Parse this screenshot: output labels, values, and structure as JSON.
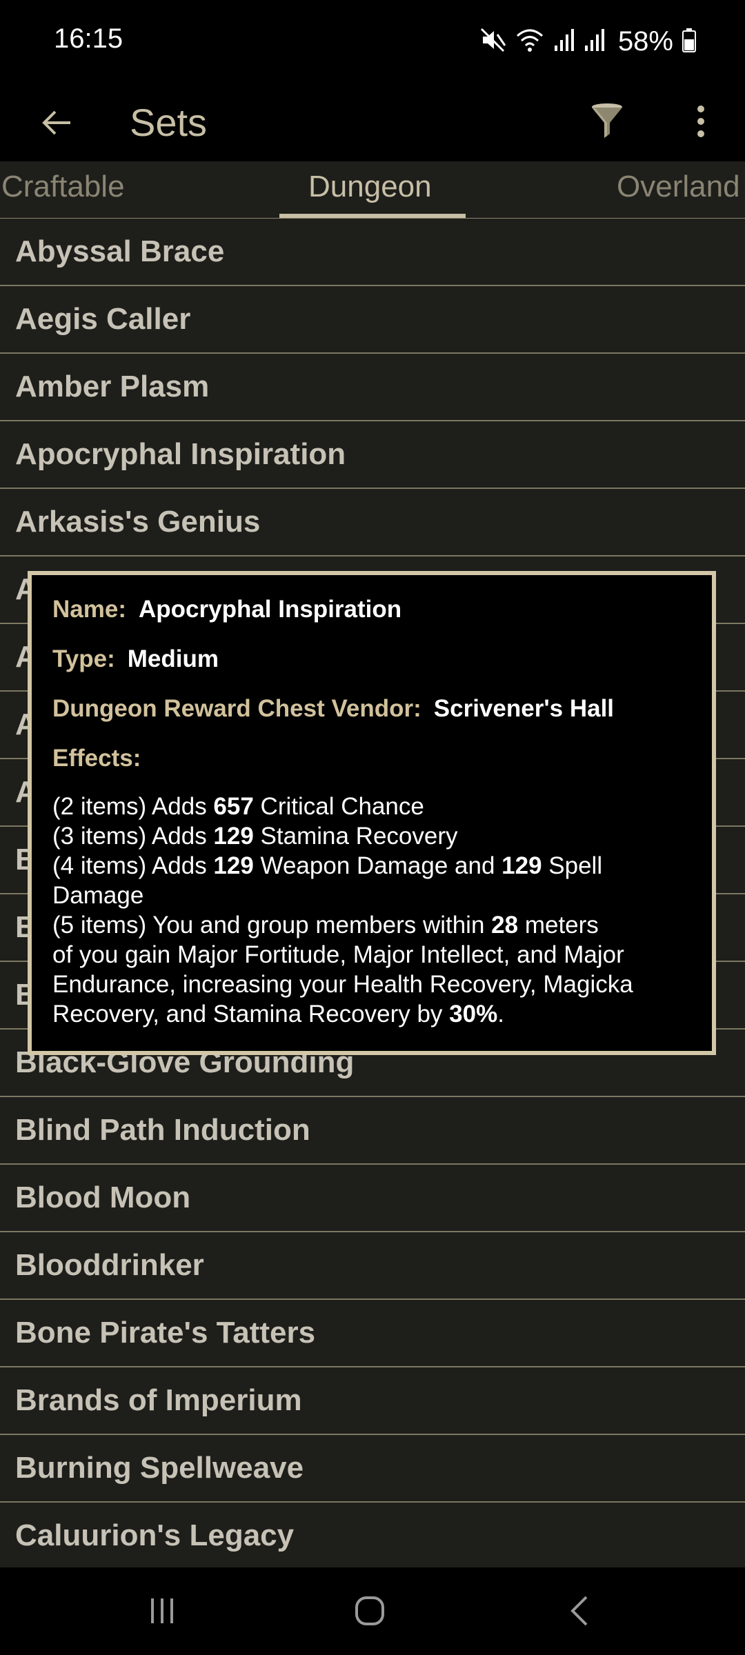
{
  "status_bar": {
    "time": "16:15",
    "battery": "58%",
    "icons": [
      "mute-icon",
      "wifi-icon",
      "signal-icon",
      "signal-icon",
      "battery-icon"
    ]
  },
  "app_bar": {
    "title": "Sets",
    "icons": {
      "back": "arrow-left-icon",
      "filter": "filter-icon",
      "more": "more-vert-icon"
    }
  },
  "tabs": [
    {
      "label": "Craftable",
      "active": false
    },
    {
      "label": "Dungeon",
      "active": true
    },
    {
      "label": "Overland",
      "active": false
    }
  ],
  "list": {
    "items": [
      "Abyssal Brace",
      "Aegis Caller",
      "Amber Plasm",
      "Apocryphal Inspiration",
      "Arkasis's Genius",
      "A",
      "A",
      "A",
      "A",
      "B",
      "B",
      "B",
      "Black-Glove Grounding",
      "Blind Path Induction",
      "Blood Moon",
      "Blooddrinker",
      "Bone Pirate's Tatters",
      "Brands of Imperium",
      "Burning Spellweave",
      "Caluurion's Legacy"
    ]
  },
  "popup": {
    "name_label": "Name:",
    "name_value": "Apocryphal Inspiration",
    "type_label": "Type:",
    "type_value": "Medium",
    "vendor_label": "Dungeon Reward Chest Vendor:",
    "vendor_value": "Scrivener's Hall",
    "effects_label": "Effects:",
    "effects": {
      "e1_pre": "(2 items) Adds ",
      "e1_num": "657",
      "e1_post": " Critical Chance",
      "e2_pre": "(3 items) Adds ",
      "e2_num": "129",
      "e2_post": " Stamina Recovery",
      "e3_pre": "(4 items) Adds ",
      "e3_num1": "129",
      "e3_mid": " Weapon Damage and ",
      "e3_num2": "129",
      "e3_post": " Spell",
      "e3_line2": "Damage",
      "e4_pre": "(5 items) You and group members within ",
      "e4_num": "28",
      "e4_post": " meters",
      "e4_line2": "of you gain Major Fortitude, Major Intellect, and Major",
      "e4_line3": "Endurance, increasing your Health Recovery, Magicka",
      "e4_line4_pre": "Recovery, and Stamina Recovery by ",
      "e4_line4_num": "30%",
      "e4_line4_post": "."
    }
  },
  "nav_bar": {
    "icons": {
      "recents": "recents-icon",
      "home": "home-icon",
      "back": "back-icon"
    }
  },
  "colors": {
    "accent": "#c7bfa6",
    "list_bg": "#1e1e1b",
    "divider": "#7d7862",
    "popup_border": "#d2c7a6",
    "label": "#d2c29c"
  }
}
